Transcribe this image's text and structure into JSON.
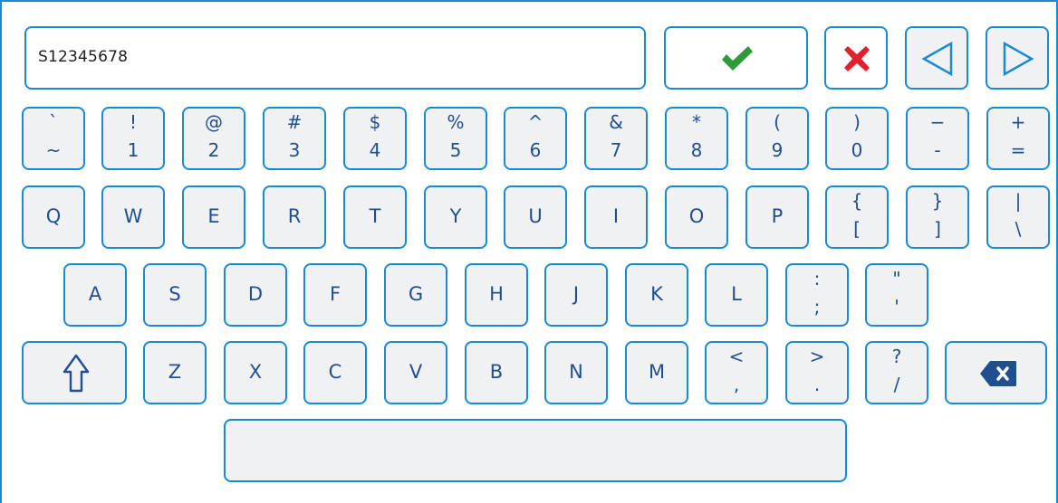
{
  "input": {
    "value": "S12345678"
  },
  "controls": {
    "confirm": "confirm-checkmark",
    "cancel": "cancel-x",
    "cursor_left": "triangle-left",
    "cursor_right": "triangle-right"
  },
  "rows": {
    "number_row": [
      {
        "upper": "`",
        "lower": "~"
      },
      {
        "upper": "!",
        "lower": "1"
      },
      {
        "upper": "@",
        "lower": "2"
      },
      {
        "upper": "#",
        "lower": "3"
      },
      {
        "upper": "$",
        "lower": "4"
      },
      {
        "upper": "%",
        "lower": "5"
      },
      {
        "upper": "^",
        "lower": "6"
      },
      {
        "upper": "&",
        "lower": "7"
      },
      {
        "upper": "*",
        "lower": "8"
      },
      {
        "upper": "(",
        "lower": "9"
      },
      {
        "upper": ")",
        "lower": "0"
      },
      {
        "upper": "−",
        "lower": "-"
      },
      {
        "upper": "+",
        "lower": "="
      }
    ],
    "qwerty_row": [
      "Q",
      "W",
      "E",
      "R",
      "T",
      "Y",
      "U",
      "I",
      "O",
      "P"
    ],
    "qwerty_symbols": [
      {
        "upper": "{",
        "lower": "["
      },
      {
        "upper": "}",
        "lower": "]"
      },
      {
        "upper": "|",
        "lower": "\\"
      }
    ],
    "home_row": [
      "A",
      "S",
      "D",
      "F",
      "G",
      "H",
      "J",
      "K",
      "L"
    ],
    "home_symbols": [
      {
        "upper": ":",
        "lower": ";"
      },
      {
        "upper": "\"",
        "lower": "'"
      }
    ],
    "bottom_row": [
      "Z",
      "X",
      "C",
      "V",
      "B",
      "N",
      "M"
    ],
    "bottom_symbols": [
      {
        "upper": "<",
        "lower": ","
      },
      {
        "upper": ">",
        "lower": "."
      },
      {
        "upper": "?",
        "lower": "/"
      }
    ]
  },
  "colors": {
    "accent": "#1a8ad4",
    "key_bg": "#f0f1f2",
    "key_text": "#1f4f8e",
    "confirm": "#2e9a3a",
    "cancel": "#e0202e"
  },
  "icons": {
    "shift": "shift-arrow-icon",
    "backspace": "backspace-icon"
  }
}
